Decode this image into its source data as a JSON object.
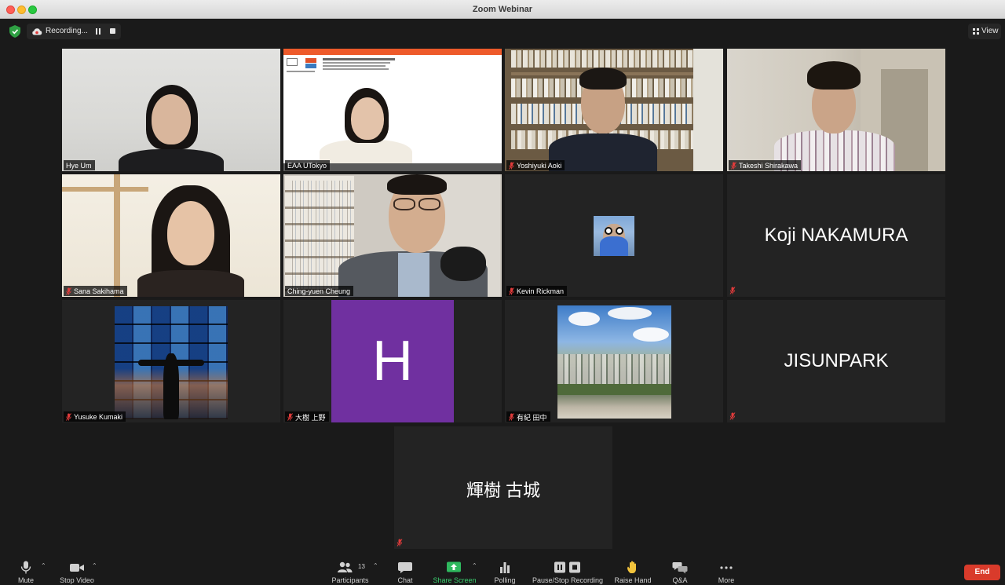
{
  "window": {
    "title": "Zoom Webinar"
  },
  "topbar": {
    "recording_label": "Recording...",
    "view_label": "View"
  },
  "tiles": [
    {
      "name": "Hye Um"
    },
    {
      "name": "EAA UTokyo"
    },
    {
      "name": "Yoshiyuki Aoki"
    },
    {
      "name": "Takeshi Shirakawa"
    },
    {
      "name": "Sana Sakihama"
    },
    {
      "name": "Ching-yuen Cheung"
    },
    {
      "name": "Kevin Rickman"
    },
    {
      "name": "",
      "display": "Koji NAKAMURA"
    },
    {
      "name": "Yusuke Kumaki"
    },
    {
      "name": "大樹 上野",
      "avatar_letter": "H"
    },
    {
      "name": "有紀 田中"
    },
    {
      "name": "",
      "display": "JISUNPARK"
    },
    {
      "name": "",
      "display": "輝樹 古城"
    }
  ],
  "toolbar": {
    "mute": "Mute",
    "stop_video": "Stop Video",
    "participants": "Participants",
    "participants_count": "13",
    "chat": "Chat",
    "share_screen": "Share Screen",
    "polling": "Polling",
    "pause_stop_recording": "Pause/Stop Recording",
    "raise_hand": "Raise Hand",
    "qa": "Q&A",
    "more": "More",
    "end": "End"
  },
  "colors": {
    "active_speaker": "#c9e07a",
    "end_button": "#d93b2b",
    "share_green": "#3cd070",
    "avatar_purple": "#7030a0"
  }
}
